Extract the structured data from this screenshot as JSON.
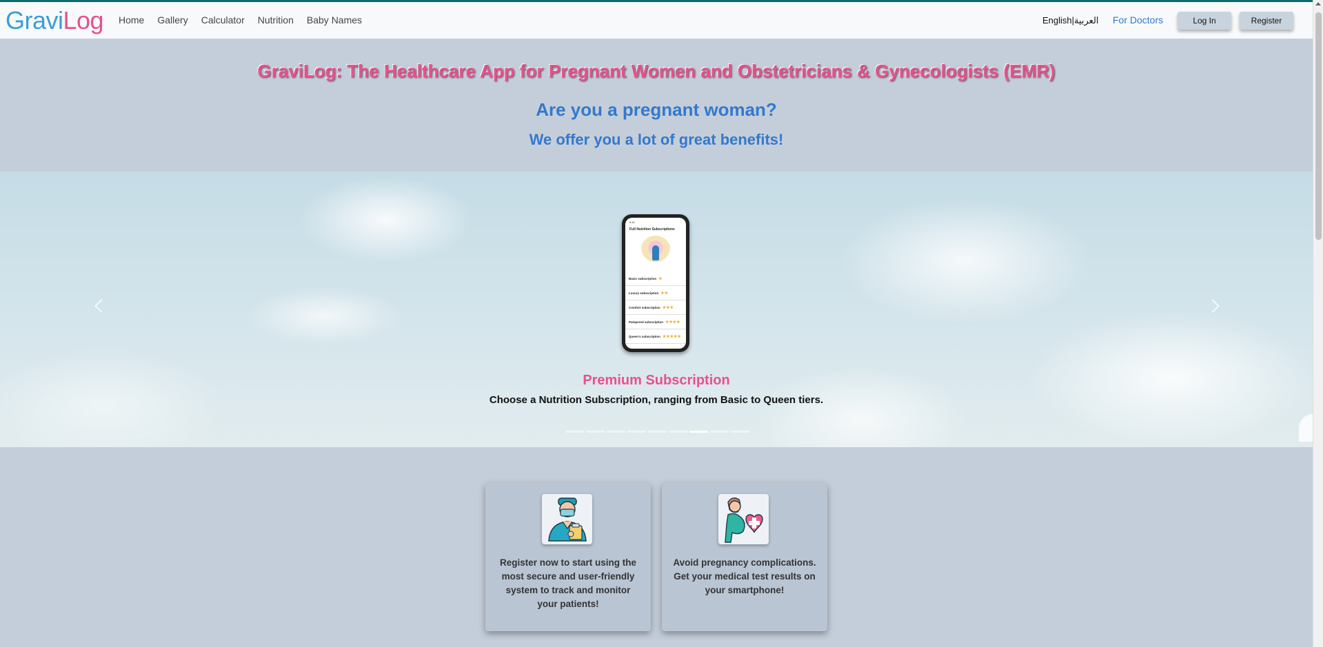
{
  "nav": {
    "logo_part1": "Gravi",
    "logo_part2": "Log",
    "links": [
      "Home",
      "Gallery",
      "Calculator",
      "Nutrition",
      "Baby Names"
    ],
    "language": "English|العربية",
    "for_doctors": "For Doctors",
    "login": "Log In",
    "register": "Register"
  },
  "hero": {
    "title": "GraviLog: The Healthcare App for Pregnant Women and Obstetricians & Gynecologists (EMR)",
    "question": "Are you a pregnant woman?",
    "subtitle": "We offer you a lot of great benefits!"
  },
  "carousel": {
    "slide_title": "Premium Subscription",
    "slide_description": "Choose a Nutrition Subscription, ranging from Basic to Queen tiers.",
    "indicator_count": 9,
    "active_index": 6,
    "phone": {
      "status": "9:41",
      "title": "Full Nutrition Subscriptions",
      "rows": [
        {
          "label": "Basic subscription",
          "stars": "★"
        },
        {
          "label": "Luxury subscription",
          "stars": "★★"
        },
        {
          "label": "Comfort subscription",
          "stars": "★★★"
        },
        {
          "label": "Pampered subscription",
          "stars": "★★★★"
        },
        {
          "label": "Queen's subscription",
          "stars": "★★★★★"
        }
      ]
    }
  },
  "cards": [
    {
      "icon": "doctor-icon",
      "text": "Register now to start using the most secure and user-friendly system to track and monitor your patients!"
    },
    {
      "icon": "pregnant-woman-heart-icon",
      "text": "Avoid pregnancy complications. Get your medical test results on your smartphone!"
    }
  ],
  "colors": {
    "brand_pink": "#e8508f",
    "brand_blue": "#3478cc",
    "background": "#c4ceda"
  }
}
